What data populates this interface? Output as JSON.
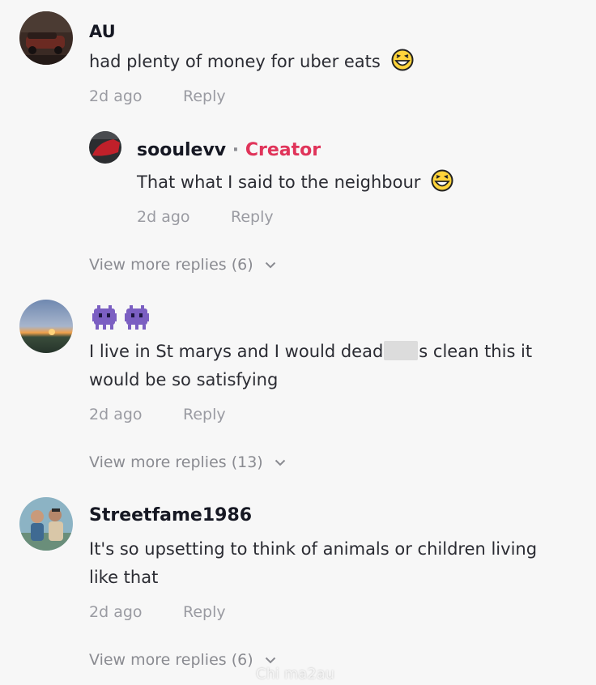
{
  "comments": [
    {
      "username": "AU",
      "text": "had plenty of money for uber eats",
      "time": "2d ago",
      "reply_label": "Reply",
      "replies": [
        {
          "username": "sooulevv",
          "separator": " · ",
          "badge": "Creator",
          "text": "That what I said to the neighbour",
          "time": "2d ago",
          "reply_label": "Reply"
        }
      ],
      "view_more": "View more replies (6)"
    },
    {
      "username_emoji": [
        "alien-monster",
        "alien-monster"
      ],
      "text_line1_a": "I live in St marys and I would dead",
      "text_line1_b": "s clean this it",
      "text_line2": "would be so satisfying",
      "time": "2d ago",
      "reply_label": "Reply",
      "view_more": "View more replies (13)"
    },
    {
      "username": "Streetfame1986",
      "text_line1": "It's so upsetting to think of animals or children living",
      "text_line2": "like that",
      "time": "2d ago",
      "reply_label": "Reply",
      "view_more": "View more replies (6)"
    }
  ],
  "watermark": "Chi ma2au",
  "colors": {
    "creator_badge": "#e0345a",
    "meta_text": "#9a9ba2",
    "background": "#f7f7f7"
  }
}
